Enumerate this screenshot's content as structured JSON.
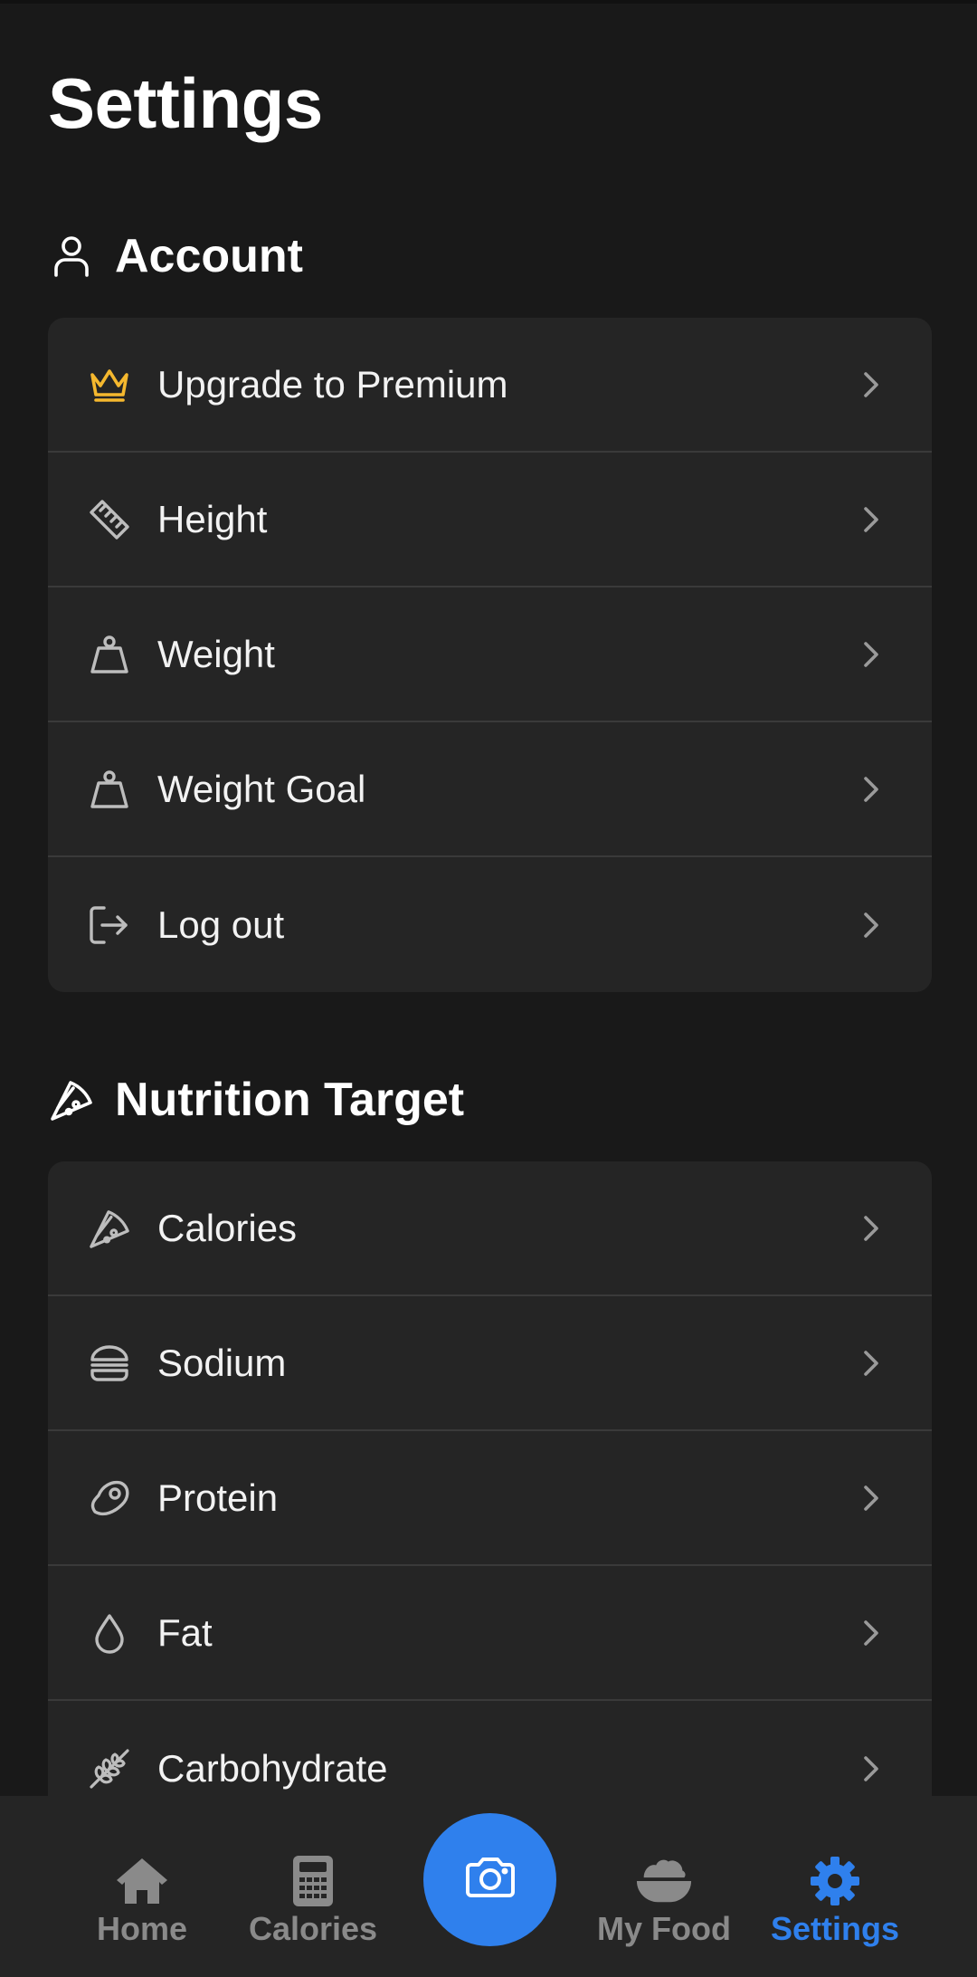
{
  "page": {
    "title": "Settings"
  },
  "theme": {
    "background": "#191919",
    "card": "#252525",
    "accent": "#2f80ed",
    "premium": "#f5b82e",
    "muted": "#8a8a8a"
  },
  "account": {
    "header": "Account",
    "icon": "user-icon",
    "items": [
      {
        "label": "Upgrade to Premium",
        "icon": "crown-icon"
      },
      {
        "label": "Height",
        "icon": "ruler-icon"
      },
      {
        "label": "Weight",
        "icon": "weight-icon"
      },
      {
        "label": "Weight Goal",
        "icon": "weight-icon"
      },
      {
        "label": "Log out",
        "icon": "logout-icon"
      }
    ]
  },
  "nutrition": {
    "header": "Nutrition Target",
    "icon": "pizza-icon",
    "items": [
      {
        "label": "Calories",
        "icon": "pizza-icon"
      },
      {
        "label": "Sodium",
        "icon": "burger-icon"
      },
      {
        "label": "Protein",
        "icon": "steak-icon"
      },
      {
        "label": "Fat",
        "icon": "drop-icon"
      },
      {
        "label": "Carbohydrate",
        "icon": "wheat-icon"
      }
    ]
  },
  "bottom_nav": {
    "items": [
      {
        "label": "Home",
        "icon": "home-icon",
        "active": false
      },
      {
        "label": "Calories",
        "icon": "calculator-icon",
        "active": false
      },
      {
        "label": "My Food",
        "icon": "bowl-icon",
        "active": false
      },
      {
        "label": "Settings",
        "icon": "gear-icon",
        "active": true
      }
    ],
    "camera_icon": "camera-icon"
  }
}
